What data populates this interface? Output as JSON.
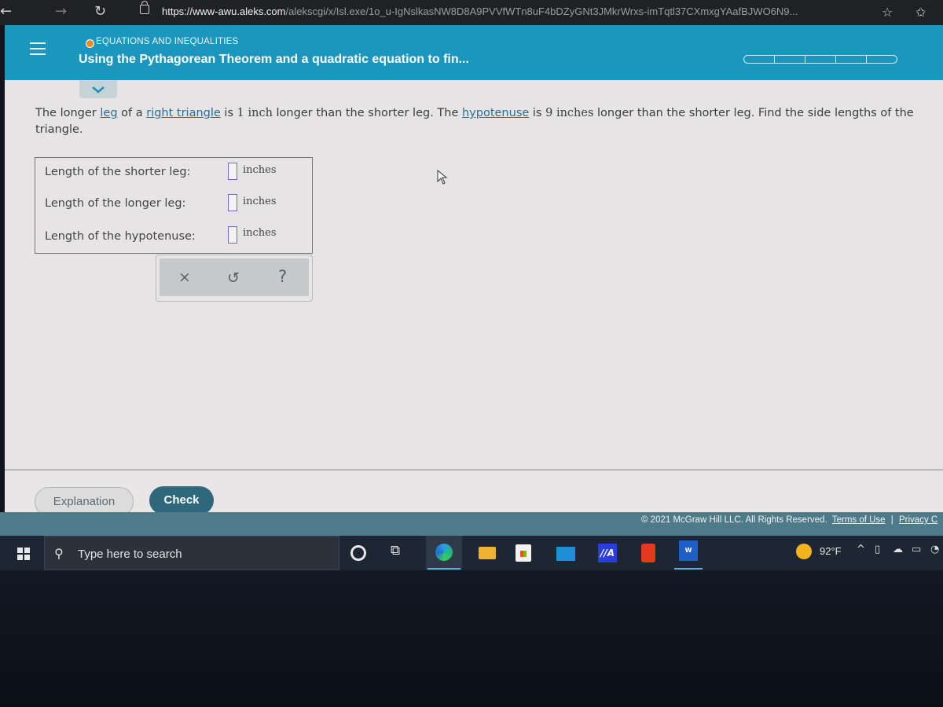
{
  "browser": {
    "url_host": "https://www-awu.aleks.com",
    "url_path": "/alekscgi/x/Isl.exe/1o_u-IgNslkasNW8D8A9PVVfWTn8uF4bDZyGNt3JMkrWrxs-imTqtl37CXmxgYAafBJWO6N9..."
  },
  "header": {
    "topic": "EQUATIONS AND INEQUALITIES",
    "title": "Using the Pythagorean Theorem and a quadratic equation to fin...",
    "progress_segments": 5,
    "progress_filled": 0
  },
  "problem": {
    "t1": "The longer ",
    "link_leg": "leg",
    "t2": " of a ",
    "link_right_triangle": "right triangle",
    "t3": " is ",
    "n1": "1",
    "t4": " inch",
    "t5": " longer than the shorter leg. The ",
    "link_hypotenuse": "hypotenuse",
    "t6": " is ",
    "n2": "9",
    "t7": " inches",
    "t8": " longer than the shorter leg. Find the side lengths of the triangle."
  },
  "answers": [
    {
      "label": "Length of the shorter leg:",
      "value": "",
      "unit": "inches"
    },
    {
      "label": "Length of the longer leg:",
      "value": "",
      "unit": "inches"
    },
    {
      "label": "Length of the hypotenuse:",
      "value": "",
      "unit": "inches"
    }
  ],
  "tools": {
    "clear": "×",
    "undo": "↺",
    "help": "?"
  },
  "buttons": {
    "explanation": "Explanation",
    "check": "Check"
  },
  "footer": {
    "copyright": "© 2021 McGraw Hill LLC. All Rights Reserved.",
    "terms": "Terms of Use",
    "separator": "|",
    "privacy": "Privacy C"
  },
  "taskbar": {
    "search_placeholder": "Type here to search",
    "weather": "92°F",
    "colors": {
      "header": "#1b97bf",
      "check_button": "#2f687d",
      "input_border": "#7367c9"
    }
  }
}
